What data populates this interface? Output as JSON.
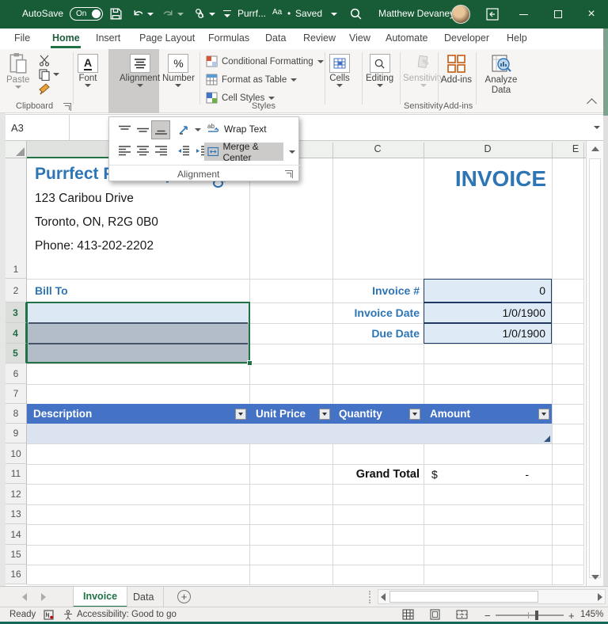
{
  "colors": {
    "titlebar_green": "#185C37",
    "accent_green": "#217346",
    "brand_blue": "#2E75B6",
    "table_header_blue": "#4472C4"
  },
  "titlebar": {
    "autosave_label": "AutoSave",
    "autosave_state": "On",
    "file_name": "Purrf...",
    "file_badge": "Aa",
    "saved_status": "Saved",
    "user_name": "Matthew Devaney"
  },
  "ribbon_tabs": [
    "File",
    "Home",
    "Insert",
    "Page Layout",
    "Formulas",
    "Data",
    "Review",
    "View",
    "Automate",
    "Developer",
    "Help"
  ],
  "ribbon": {
    "paste": "Paste",
    "clipboard_group": "Clipboard",
    "font": "Font",
    "font_icon": "A",
    "alignment": "Alignment",
    "number": "Number",
    "number_icon": "%",
    "styles": [
      "Conditional Formatting",
      "Format as Table",
      "Cell Styles"
    ],
    "styles_group": "Styles",
    "cells": "Cells",
    "editing": "Editing",
    "sensitivity": "Sensitivity",
    "sensitivity_group": "Sensitivity",
    "addins": "Add-ins",
    "addins_group": "Add-ins",
    "analyze_data": "Analyze Data"
  },
  "alignment_flyout": {
    "wrap_text": "Wrap Text",
    "merge_center": "Merge & Center",
    "group_label": "Alignment"
  },
  "formula_bar": {
    "name_box": "A3",
    "formula": ""
  },
  "grid": {
    "visible_columns": [
      "C",
      "D",
      "E"
    ],
    "row_numbers": [
      "1",
      "2",
      "3",
      "4",
      "5",
      "6",
      "7",
      "8",
      "9",
      "10",
      "11",
      "12",
      "13",
      "14",
      "15",
      "16"
    ]
  },
  "sheet": {
    "company_name": "Purrfect Pet Shop",
    "address_line1": "123 Caribou Drive",
    "address_line2": "Toronto, ON, R2G 0B0",
    "phone": "Phone: 413-202-2202",
    "invoice_title": "INVOICE",
    "bill_to": "Bill To",
    "fields": [
      {
        "label": "Invoice #",
        "value": "0"
      },
      {
        "label": "Invoice Date",
        "value": "1/0/1900"
      },
      {
        "label": "Due Date",
        "value": "1/0/1900"
      }
    ],
    "table_headers": [
      "Description",
      "Unit Price",
      "Quantity",
      "Amount"
    ],
    "grand_total_label": "Grand Total",
    "currency_symbol": "$",
    "grand_total_value": "-"
  },
  "sheet_tabs": {
    "tabs": [
      "Invoice",
      "Data"
    ],
    "active": "Invoice"
  },
  "status_bar": {
    "ready": "Ready",
    "accessibility": "Accessibility: Good to go",
    "zoom_out": "−",
    "zoom_in": "+",
    "zoom_level": "145%"
  }
}
